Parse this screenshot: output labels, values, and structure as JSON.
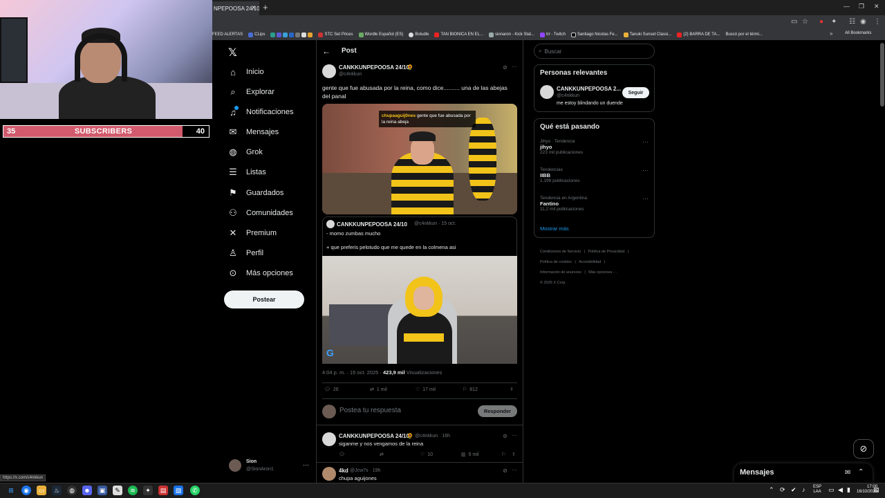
{
  "overlay": {
    "subscribers": {
      "current": "35",
      "label": "SUBSCRIBERS",
      "goal": "40"
    }
  },
  "browser": {
    "tab_title": "NPEPOOSA 24/10",
    "bookmarks": [
      "FEED ALERTAS",
      "CLips",
      "STC Set Prices",
      "Wordle Español (ES)",
      "Boludle",
      "TAN BIONICA EN EL...",
      "sionaron - Kick Stat...",
      "trr - Twitch",
      "Santiago Nicolas Fe...",
      "Tanuki Sunset Classi...",
      "(2) BARRA DE TA...",
      "Buscó por el térmi..."
    ],
    "all_bookmarks": "All Bookmarks",
    "status_url": "https://x.com/c4nkkun"
  },
  "nav": {
    "items": [
      {
        "label": "Inicio",
        "icon": "home-icon",
        "glyph": "⌂"
      },
      {
        "label": "Explorar",
        "icon": "search-icon",
        "glyph": "⌕"
      },
      {
        "label": "Notificaciones",
        "icon": "bell-icon",
        "glyph": "🔔"
      },
      {
        "label": "Mensajes",
        "icon": "mail-icon",
        "glyph": "✉"
      },
      {
        "label": "Grok",
        "icon": "grok-icon",
        "glyph": "◍"
      },
      {
        "label": "Listas",
        "icon": "list-icon",
        "glyph": "☰"
      },
      {
        "label": "Guardados",
        "icon": "bookmark-icon",
        "glyph": "⚑"
      },
      {
        "label": "Comunidades",
        "icon": "communities-icon",
        "glyph": "⚇"
      },
      {
        "label": "Premium",
        "icon": "x-icon",
        "glyph": "✕"
      },
      {
        "label": "Perfil",
        "icon": "person-icon",
        "glyph": "♙"
      },
      {
        "label": "Más opciones",
        "icon": "more-circle-icon",
        "glyph": "⋯"
      }
    ],
    "post_button": "Postear",
    "profile": {
      "name": "Sion",
      "handle": "@SionAron1"
    }
  },
  "post": {
    "header": "Post",
    "author": "CANKKUNPEPOOSA 24/10",
    "handle": "@c4nkkun",
    "text": "gente que fue abusada por la reina, como dice.......... una de las abejas del panal",
    "media_caption_user": "chupaaguij0nes",
    "media_caption_text": "gente que fue abusada por la reina abeja",
    "quote": {
      "author": "CANKKUNPEPOOSA 24/10",
      "handle": "@c4nkkun · 15 oct.",
      "line1": "- momo zumbas mucho",
      "line2": "+ que preferis pelotudo que me quede en la colmena asi"
    },
    "time": "4:04 p. m. · 15 oct. 2025 ·",
    "views": "423,9 mil",
    "views_label": "Visualizaciones",
    "stats": {
      "replies": "26",
      "reposts": "1 mil",
      "likes": "17 mil",
      "bookmarks": "812"
    },
    "reply_placeholder": "Postea tu respuesta",
    "reply_button": "Responder"
  },
  "replies": [
    {
      "author": "CANKKUNPEPOOSA 24/10",
      "handle": "@c4nkkun · 16h",
      "text": "siganme y nos vengamos de la reina",
      "likes": "10",
      "views": "6 mil"
    },
    {
      "author": "4kd",
      "handle": "@Jcw7s · 19h",
      "text": "chupa aguijones"
    }
  ],
  "sidebar": {
    "search_placeholder": "Buscar",
    "relevant": {
      "title": "Personas relevantes",
      "name": "CANKKUNPEPOOSA 2...",
      "handle": "@c4nkkun",
      "bio": "me estoy blindando un duende",
      "follow": "Seguir"
    },
    "trending": {
      "title": "Qué está pasando",
      "items": [
        {
          "context": "Jihyo · Tendencia",
          "name": "jihyo",
          "count": "223 mil publicaciones"
        },
        {
          "context": "Tendencias",
          "name": "IIBB",
          "count": "1.199 publicaciones"
        },
        {
          "context": "Tendencia en Argentina",
          "name": "Fantino",
          "count": "11,2 mil publicaciones"
        }
      ],
      "show_more": "Mostrar más"
    },
    "footer": {
      "line1": [
        "Condiciones de Servicio",
        "Política de Privacidad"
      ],
      "line2": [
        "Política de cookies",
        "Accesibilidad"
      ],
      "line3": [
        "Información de anuncios",
        "Más opciones ···"
      ],
      "copyright": "© 2025 X Corp."
    }
  },
  "messages": {
    "title": "Mensajes"
  },
  "taskbar": {
    "lang1": "ESP",
    "lang2": "LAA",
    "time": "17:00",
    "date": "16/10/2025"
  }
}
